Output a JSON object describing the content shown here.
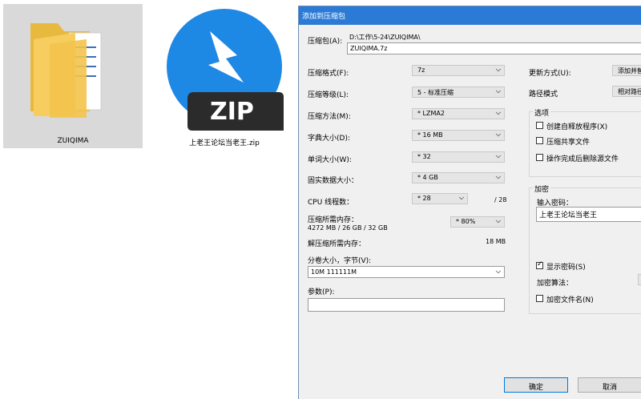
{
  "desktop": {
    "folder_label": "ZUIQIMA",
    "zip_label": "上老王论坛当老王.zip",
    "zip_badge": "ZIP"
  },
  "dialog": {
    "title": "添加到压缩包",
    "archive_label": "压缩包(A):",
    "archive_path": "D:\\工作\\5-24\\ZUIQIMA\\",
    "archive_name": "ZUIQIMA.7z",
    "format_label": "压缩格式(F):",
    "format_value": "7z",
    "level_label": "压缩等级(L):",
    "level_value": "5 - 标准压缩",
    "method_label": "压缩方法(M):",
    "method_value": "* LZMA2",
    "dict_label": "字典大小(D):",
    "dict_value": "* 16 MB",
    "word_label": "单词大小(W):",
    "word_value": "* 32",
    "solid_label": "固实数据大小：",
    "solid_value": "* 4 GB",
    "cpu_label": "CPU 线程数：",
    "cpu_value": "* 28",
    "cpu_max": "/ 28",
    "mem_comp_label": "压缩所需内存：",
    "mem_comp_detail": "4272 MB / 26 GB / 32 GB",
    "mem_comp_value": "* 80%",
    "mem_decomp_label": "解压缩所需内存：",
    "mem_decomp_value": "18 MB",
    "split_label": "分卷大小，字节(V):",
    "split_value": "10M 111111M",
    "params_label": "参数(P):",
    "params_value": "",
    "update_label": "更新方式(U):",
    "update_value": "添加并替",
    "path_label": "路径模式",
    "path_value": "相对路径",
    "options_title": "选项",
    "opt_sfx": "创建自释放程序(X)",
    "opt_shared": "压缩共享文件",
    "opt_delete": "操作完成后删除源文件",
    "encrypt_title": "加密",
    "password_label": "输入密码：",
    "password_value": "上老王论坛当老王",
    "show_password": "显示密码(S)",
    "enc_method_label": "加密算法：",
    "enc_filenames": "加密文件名(N)",
    "ok_label": "确定",
    "cancel_label": "取消"
  },
  "colors": {
    "titlebar": "#2b7bd6",
    "zip_circle": "#1e88e5",
    "folder": "#f6cd5e"
  },
  "icons": [
    "folder-icon",
    "zip-archive-icon",
    "lightning-icon",
    "dropdown-arrow-icon",
    "checkbox-icon"
  ]
}
